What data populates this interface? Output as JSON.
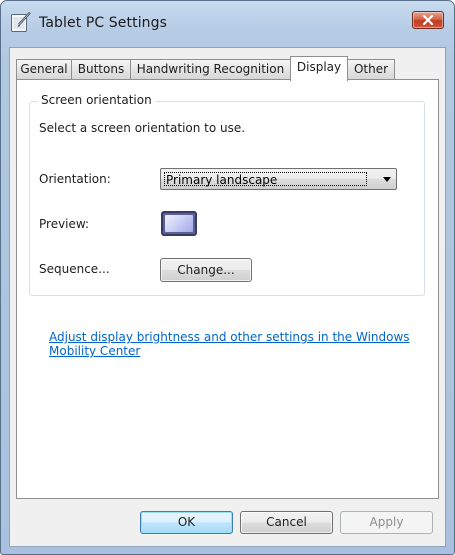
{
  "window": {
    "title": "Tablet PC Settings"
  },
  "tabs": [
    {
      "label": "General",
      "active": false
    },
    {
      "label": "Buttons",
      "active": false
    },
    {
      "label": "Handwriting Recognition",
      "active": false
    },
    {
      "label": "Display",
      "active": true
    },
    {
      "label": "Other",
      "active": false
    }
  ],
  "screen_orientation": {
    "group_label": "Screen orientation",
    "instruction": "Select a screen orientation to use.",
    "orientation_label": "Orientation:",
    "orientation_value": "Primary landscape",
    "preview_label": "Preview:",
    "sequence_label": "Sequence...",
    "change_button": "Change..."
  },
  "mobility_link": "Adjust display brightness and other settings in the Windows Mobility Center",
  "footer": {
    "ok": "OK",
    "cancel": "Cancel",
    "apply": "Apply",
    "apply_enabled": false
  },
  "icons": {
    "title": "tablet-pen-icon",
    "close": "close-icon",
    "dropdown": "chevron-down-icon"
  },
  "colors": {
    "link": "#0066cc",
    "close_button": "#c13b21",
    "title_bar": "#b7cde6"
  }
}
